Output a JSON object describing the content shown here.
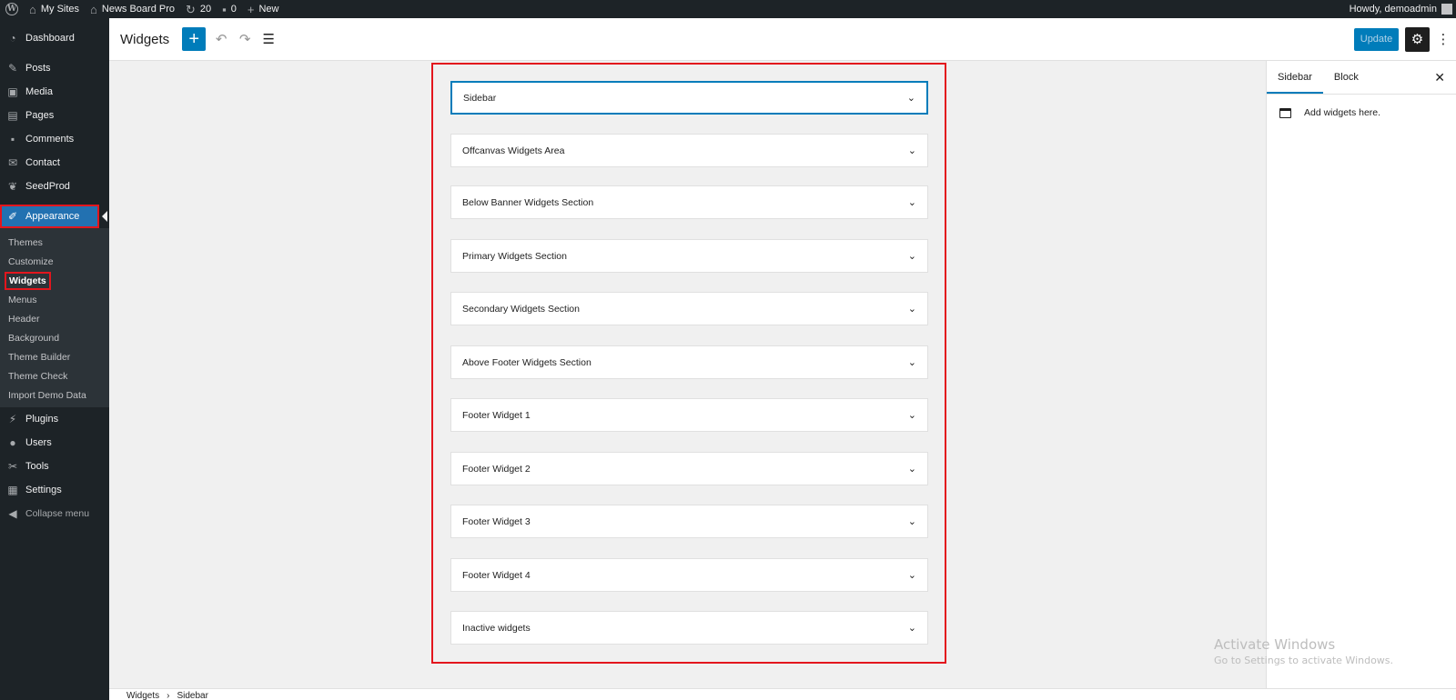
{
  "admin_bar": {
    "my_sites": "My Sites",
    "site_name": "News Board Pro",
    "updates_count": "20",
    "comments_count": "0",
    "new_label": "New",
    "howdy": "Howdy, demoadmin"
  },
  "menu": {
    "dashboard": "Dashboard",
    "posts": "Posts",
    "media": "Media",
    "pages": "Pages",
    "comments": "Comments",
    "contact": "Contact",
    "seedprod": "SeedProd",
    "appearance": "Appearance",
    "submenu": {
      "themes": "Themes",
      "customize": "Customize",
      "widgets": "Widgets",
      "menus": "Menus",
      "header": "Header",
      "background": "Background",
      "theme_builder": "Theme Builder",
      "theme_check": "Theme Check",
      "import_demo_data": "Import Demo Data"
    },
    "plugins": "Plugins",
    "users": "Users",
    "tools": "Tools",
    "settings": "Settings",
    "collapse": "Collapse menu"
  },
  "header": {
    "title": "Widgets",
    "add_symbol": "+",
    "update_label": "Update"
  },
  "widget_areas": [
    "Sidebar",
    "Offcanvas Widgets Area",
    "Below Banner Widgets Section",
    "Primary Widgets Section",
    "Secondary Widgets Section",
    "Above Footer Widgets Section",
    "Footer Widget 1",
    "Footer Widget 2",
    "Footer Widget 3",
    "Footer Widget 4",
    "Inactive widgets"
  ],
  "inspector": {
    "tab_sidebar": "Sidebar",
    "tab_block": "Block",
    "empty_text": "Add widgets here."
  },
  "watermark": {
    "title": "Activate Windows",
    "subtitle": "Go to Settings to activate Windows."
  },
  "breadcrumb": {
    "root": "Widgets",
    "current": "Sidebar"
  },
  "colors": {
    "accent": "#007cba",
    "admin_dark": "#1d2327",
    "highlight_red": "#e3161d",
    "menu_current": "#2271b1"
  }
}
